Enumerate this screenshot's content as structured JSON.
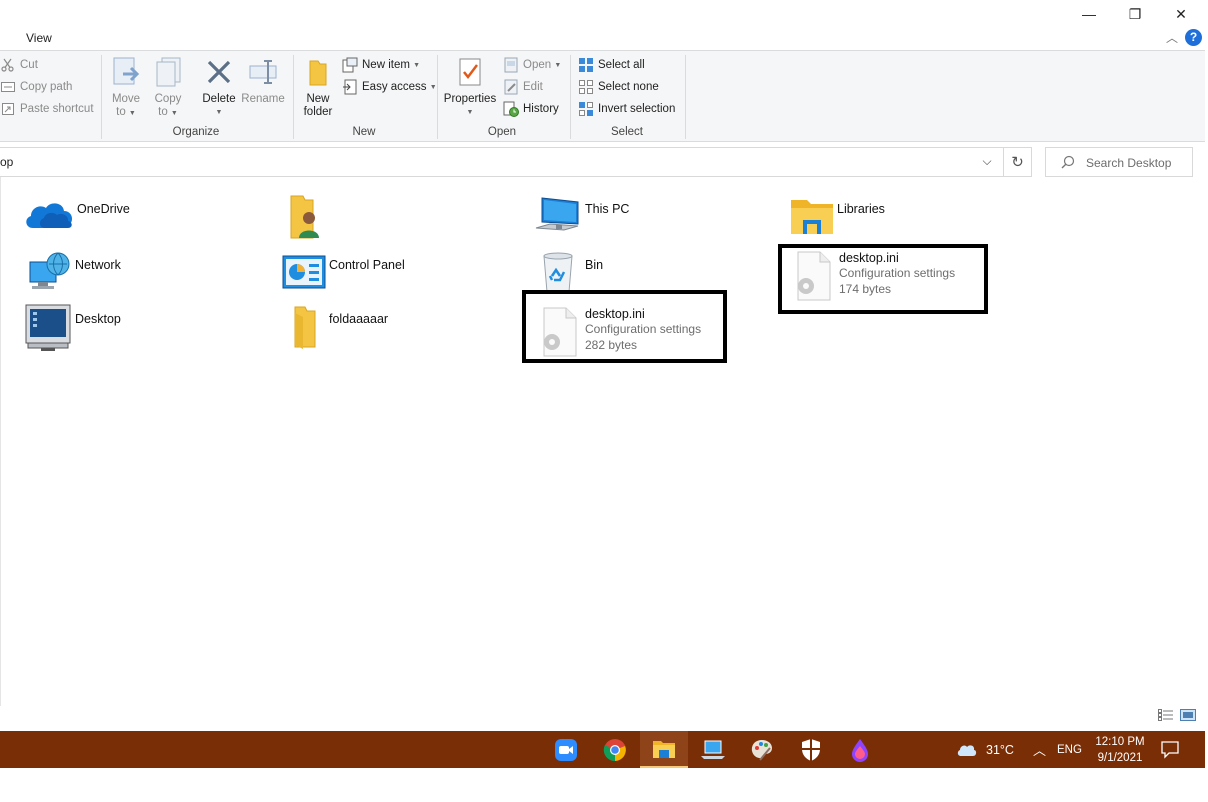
{
  "window": {
    "minimize_glyph": "—",
    "restore_glyph": "❐",
    "close_glyph": "✕"
  },
  "tabs": {
    "view": "View"
  },
  "ribbon": {
    "clipboard": {
      "cut": "Cut",
      "copy_path": "Copy path",
      "paste_shortcut": "Paste shortcut"
    },
    "organize": {
      "label": "Organize",
      "move_to": [
        "Move",
        "to"
      ],
      "copy_to": [
        "Copy",
        "to"
      ],
      "delete": "Delete",
      "rename": "Rename"
    },
    "new": {
      "label": "New",
      "new_folder": [
        "New",
        "folder"
      ],
      "new_item": "New item",
      "easy_access": "Easy access"
    },
    "open": {
      "label": "Open",
      "properties": "Properties",
      "open": "Open",
      "edit": "Edit",
      "history": "History"
    },
    "select": {
      "label": "Select",
      "select_all": "Select all",
      "select_none": "Select none",
      "invert_selection": "Invert selection"
    }
  },
  "address": {
    "path_fragment": "op",
    "search_placeholder": "Search Desktop"
  },
  "items": {
    "onedrive": "OneDrive",
    "this_pc": "This PC",
    "libraries": "Libraries",
    "network": "Network",
    "control_panel": "Control Panel",
    "bin": "Bin",
    "desktop": "Desktop",
    "foldaaaaar": "foldaaaaar",
    "ini1": {
      "name": "desktop.ini",
      "type": "Configuration settings",
      "size": "282 bytes"
    },
    "ini2": {
      "name": "desktop.ini",
      "type": "Configuration settings",
      "size": "174 bytes"
    }
  },
  "taskbar": {
    "temperature": "31°C",
    "language": "ENG",
    "time": "12:10 PM",
    "date": "9/1/2021",
    "color": "#7a2e06"
  }
}
